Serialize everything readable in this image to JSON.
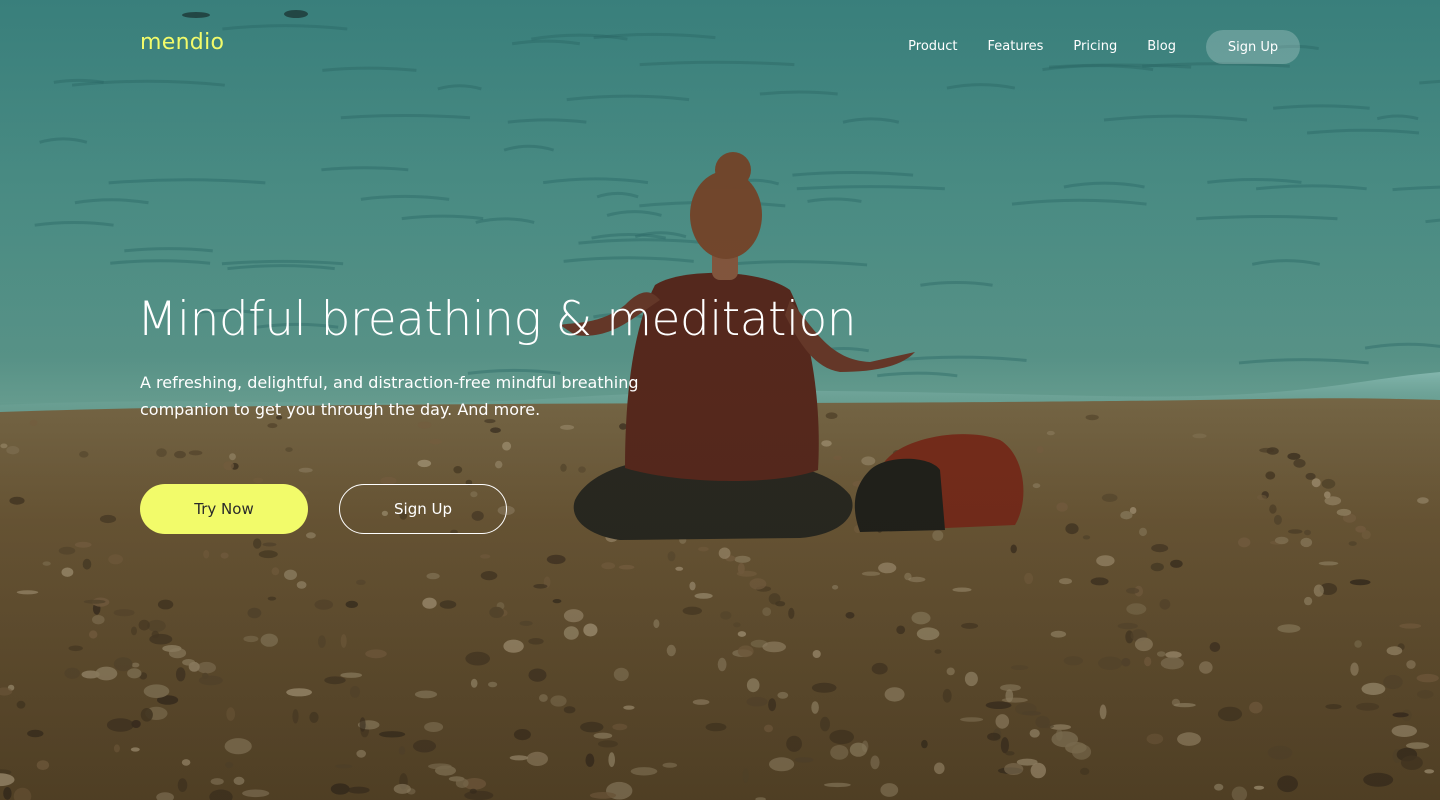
{
  "brand": {
    "logo_text": "mendio",
    "accent_color": "#f2fb6a"
  },
  "nav": {
    "links": [
      {
        "label": "Product"
      },
      {
        "label": "Features"
      },
      {
        "label": "Pricing"
      },
      {
        "label": "Blog"
      }
    ],
    "signup_label": "Sign Up"
  },
  "hero": {
    "headline": "Mindful breathing & meditation",
    "subheadline": "A refreshing, delightful, and distraction-free mindful breathing companion to get you through the day. And more.",
    "primary_cta": "Try Now",
    "secondary_cta": "Sign Up",
    "background_image": "woman meditating cross-legged on a pebble beach facing the sea, with a backpack beside her"
  }
}
